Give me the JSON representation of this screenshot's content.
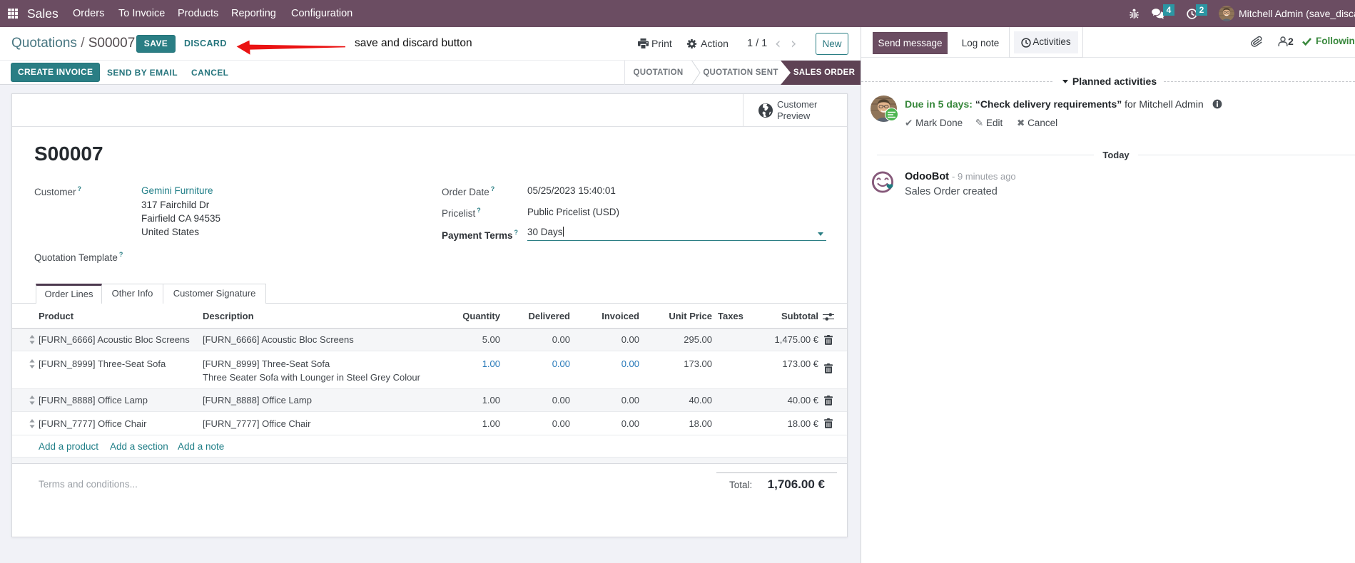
{
  "navbar": {
    "app_name": "Sales",
    "menus": [
      "Orders",
      "To Invoice",
      "Products",
      "Reporting",
      "Configuration"
    ],
    "message_badge": "4",
    "activity_badge": "2",
    "user_name": "Mitchell Admin (save_discard",
    "bg_color": "#6b4d62",
    "badge_color": "#2b96a3"
  },
  "breadcrumb": {
    "parent": "Quotations",
    "separator": "/",
    "current": "S00007",
    "save_label": "SAVE",
    "discard_label": "DISCARD",
    "annotation": "save and discard button",
    "print_label": "Print",
    "action_label": "Action",
    "pager": "1 / 1",
    "new_label": "New"
  },
  "toolbar": {
    "create_invoice_label": "CREATE INVOICE",
    "send_by_email_label": "SEND BY EMAIL",
    "cancel_label": "CANCEL",
    "states": [
      "QUOTATION",
      "QUOTATION SENT",
      "SALES ORDER"
    ],
    "active_state": "SALES ORDER",
    "active_color": "#5e4254"
  },
  "sheet": {
    "preview_line1": "Customer",
    "preview_line2": "Preview",
    "title": "S00007",
    "fields": {
      "customer_label": "Customer",
      "customer_value": "Gemini Furniture",
      "address_line1": "317 Fairchild Dr",
      "address_line2": "Fairfield CA 94535",
      "address_line3": "United States",
      "quotation_template_label": "Quotation Template",
      "order_date_label": "Order Date",
      "order_date_value": "05/25/2023 15:40:01",
      "pricelist_label": "Pricelist",
      "pricelist_value": "Public Pricelist (USD)",
      "payment_terms_label": "Payment Terms",
      "payment_terms_value": "30 Days"
    },
    "tabs": [
      "Order Lines",
      "Other Info",
      "Customer Signature"
    ],
    "active_tab": "Order Lines",
    "table": {
      "headers": [
        "Product",
        "Description",
        "Quantity",
        "Delivered",
        "Invoiced",
        "Unit Price",
        "Taxes",
        "Subtotal"
      ],
      "rows": [
        {
          "product": "[FURN_6666] Acoustic Bloc Screens",
          "description": "[FURN_6666] Acoustic Bloc Screens",
          "description2": "",
          "quantity": "5.00",
          "delivered": "0.00",
          "invoiced": "0.00",
          "unit_price": "295.00",
          "taxes": "",
          "subtotal": "1,475.00 €"
        },
        {
          "product": "[FURN_8999] Three-Seat Sofa",
          "description": "[FURN_8999] Three-Seat Sofa",
          "description2": "Three Seater Sofa with Lounger in Steel Grey Colour",
          "quantity": "1.00",
          "delivered": "0.00",
          "invoiced": "0.00",
          "unit_price": "173.00",
          "taxes": "",
          "subtotal": "173.00 €"
        },
        {
          "product": "[FURN_8888] Office Lamp",
          "description": "[FURN_8888] Office Lamp",
          "description2": "",
          "quantity": "1.00",
          "delivered": "0.00",
          "invoiced": "0.00",
          "unit_price": "40.00",
          "taxes": "",
          "subtotal": "40.00 €"
        },
        {
          "product": "[FURN_7777] Office Chair",
          "description": "[FURN_7777] Office Chair",
          "description2": "",
          "quantity": "1.00",
          "delivered": "0.00",
          "invoiced": "0.00",
          "unit_price": "18.00",
          "taxes": "",
          "subtotal": "18.00 €"
        }
      ],
      "add_product_label": "Add a product",
      "add_section_label": "Add a section",
      "add_note_label": "Add a note"
    },
    "terms_placeholder": "Terms and conditions...",
    "total_label": "Total:",
    "total_value": "1,706.00 €"
  },
  "chatter": {
    "send_message_label": "Send message",
    "log_note_label": "Log note",
    "activities_label": "Activities",
    "followers_count": "2",
    "following_label": "Following",
    "planned_title": "Planned activities",
    "activity": {
      "due": "Due in 5 days:",
      "summary": "“Check delivery requirements”",
      "assignee": "for Mitchell Admin",
      "mark_done_label": "Mark Done",
      "edit_label": "Edit",
      "cancel_label": "Cancel"
    },
    "today_label": "Today",
    "message": {
      "author": "OdooBot",
      "date": "- 9 minutes ago",
      "body": "Sales Order created"
    }
  }
}
